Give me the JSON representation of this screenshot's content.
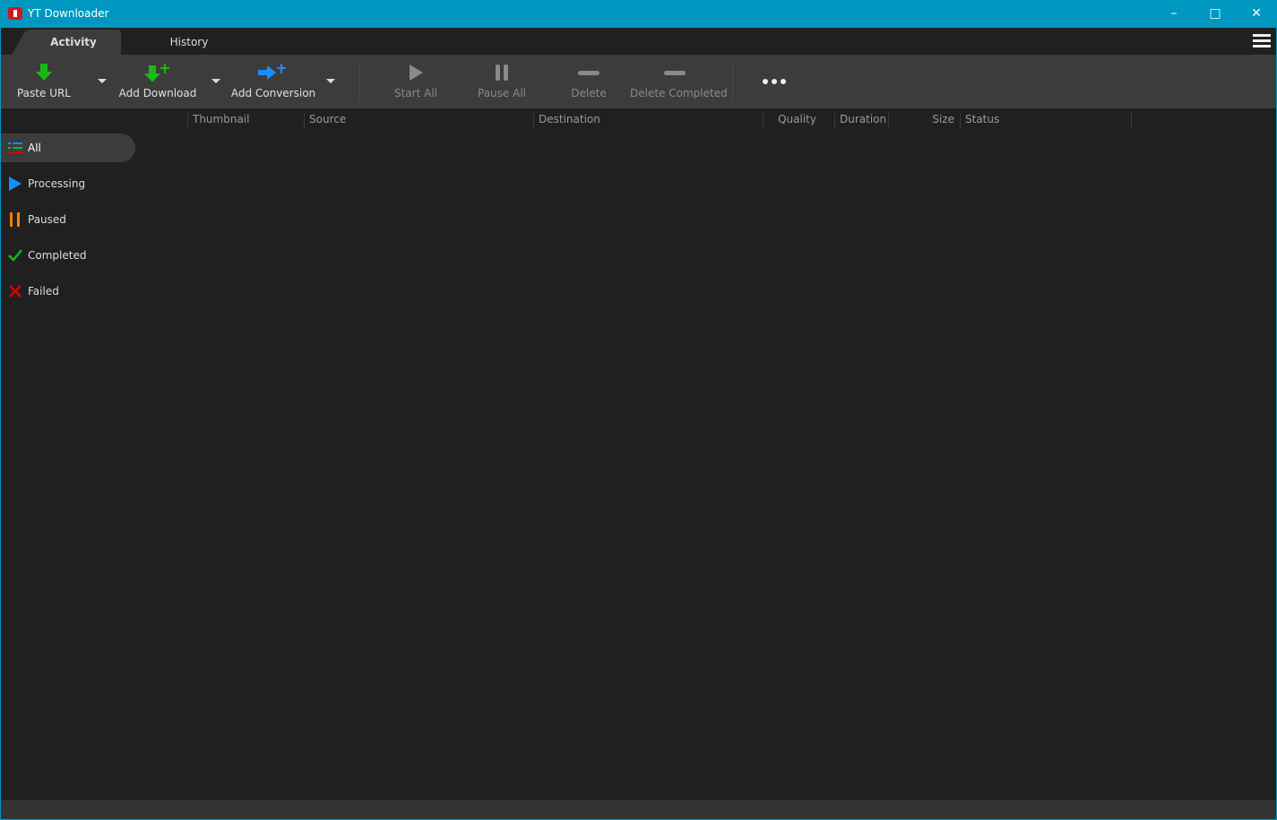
{
  "window": {
    "title": "YT Downloader"
  },
  "tabs": [
    {
      "label": "Activity"
    },
    {
      "label": "History"
    }
  ],
  "toolbar": {
    "paste_url": "Paste URL",
    "add_download": "Add Download",
    "add_conversion": "Add Conversion",
    "start_all": "Start All",
    "pause_all": "Pause All",
    "delete": "Delete",
    "delete_completed": "Delete Completed"
  },
  "columns": [
    "Thumbnail",
    "Source",
    "Destination",
    "Quality",
    "Duration",
    "Size",
    "Status"
  ],
  "sidebar": {
    "items": [
      {
        "label": "All"
      },
      {
        "label": "Processing"
      },
      {
        "label": "Paused"
      },
      {
        "label": "Completed"
      },
      {
        "label": "Failed"
      }
    ]
  },
  "colors": {
    "accent": "#0098c0",
    "green": "#18b818",
    "blue": "#1a8cff",
    "orange": "#ff8000",
    "red": "#e00000"
  }
}
